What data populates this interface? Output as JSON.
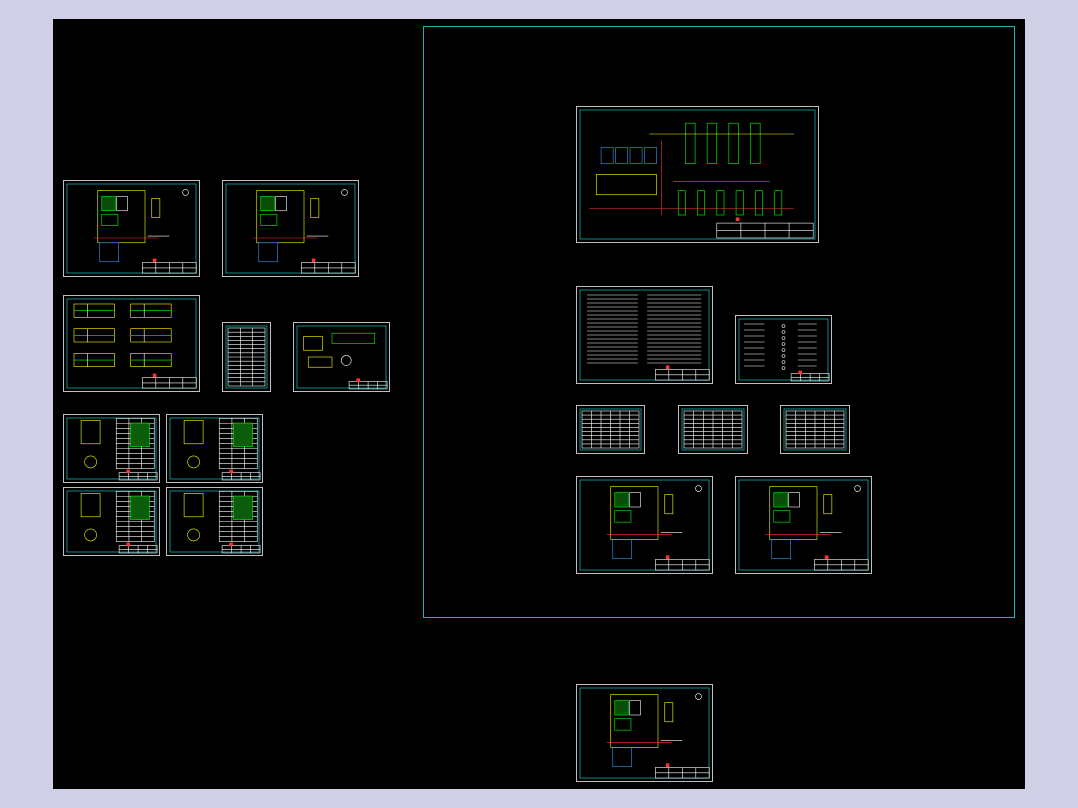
{
  "viewport": {
    "background": "#000000",
    "outer_background": "#cfcfe6",
    "frame_color": "#19b3b3"
  },
  "palette": {
    "sheet_border": "#bfbfbf",
    "inner_border": "#19e5e5",
    "primary_lines": "#ffff00",
    "secondary_lines": "#00ff00",
    "accent_lines": "#ff3333",
    "text_lines": "#ffffff",
    "blue_lines": "#3399ff"
  },
  "sheets": [
    {
      "id": "floor-plan-a",
      "kind": "plan"
    },
    {
      "id": "floor-plan-b",
      "kind": "plan"
    },
    {
      "id": "section-details",
      "kind": "sections"
    },
    {
      "id": "material-schedule",
      "kind": "table"
    },
    {
      "id": "equipment-detail",
      "kind": "detail"
    },
    {
      "id": "tank-detail-1",
      "kind": "tank"
    },
    {
      "id": "tank-detail-2",
      "kind": "tank"
    },
    {
      "id": "tank-detail-3",
      "kind": "tank"
    },
    {
      "id": "tank-detail-4",
      "kind": "tank"
    },
    {
      "id": "process-flow-diagram",
      "kind": "flow"
    },
    {
      "id": "general-notes",
      "kind": "notes"
    },
    {
      "id": "legend-sheet",
      "kind": "legend"
    },
    {
      "id": "schedule-1",
      "kind": "table"
    },
    {
      "id": "schedule-2",
      "kind": "table"
    },
    {
      "id": "schedule-3",
      "kind": "table"
    },
    {
      "id": "floor-plan-c",
      "kind": "plan"
    },
    {
      "id": "floor-plan-d",
      "kind": "plan"
    },
    {
      "id": "floor-plan-e",
      "kind": "plan"
    }
  ]
}
